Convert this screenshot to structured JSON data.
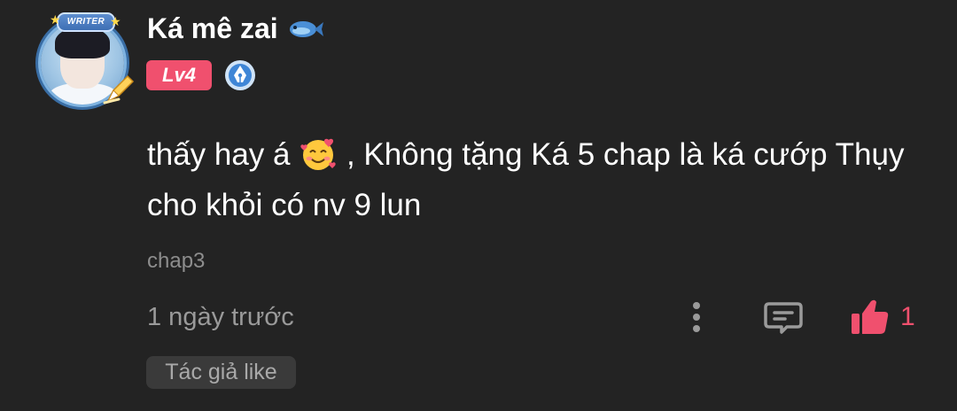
{
  "comment": {
    "author": {
      "name": "Ká mê zai",
      "name_icon": "fish-icon",
      "avatar_frame_label": "WRITER",
      "level": "Lv4",
      "badge_icon": "pen-nib-badge-icon"
    },
    "text_part1": "thấy hay á",
    "emoji": "smiling-face-with-hearts-icon",
    "text_part2": ", Không tặng Ká 5 chap là ká cướp Thụy cho khỏi có nv 9 lun",
    "chapter": "chap3",
    "timestamp": "1 ngày trước",
    "actions": {
      "more_icon": "more-vertical-icon",
      "reply_icon": "comment-reply-icon",
      "like_icon": "thumbs-up-icon",
      "like_count": "1"
    },
    "author_liked_label": "Tác giả like"
  },
  "colors": {
    "background": "#232323",
    "accent": "#f0506e",
    "muted_text": "#9a9a9a",
    "badge_background": "#3a3a3a",
    "pen_badge_blue": "#3f86d6"
  }
}
